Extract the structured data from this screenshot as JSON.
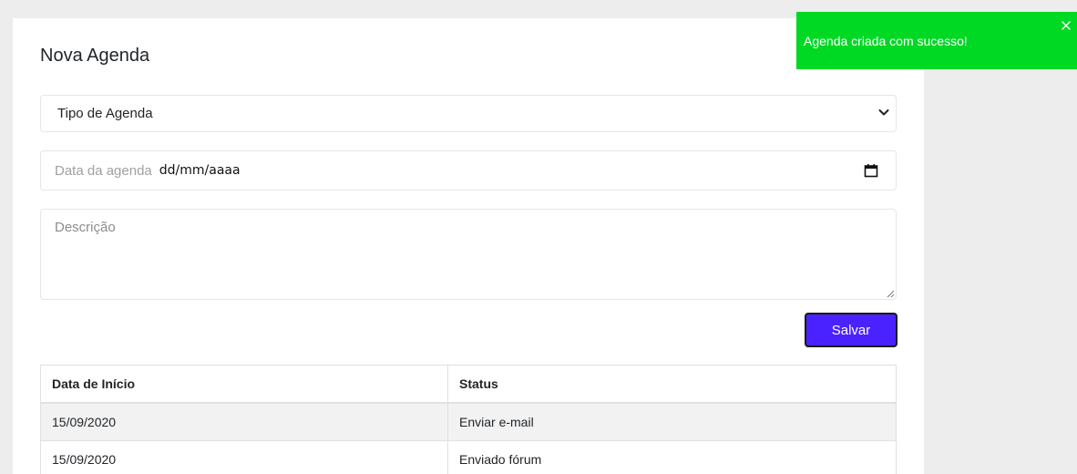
{
  "form": {
    "title": "Nova Agenda",
    "type_select": {
      "selected": "Tipo de Agenda"
    },
    "date_field": {
      "label": "Data da agenda",
      "value": "dd/mm/aaaa"
    },
    "description_field": {
      "placeholder": "Descrição"
    },
    "save_label": "Salvar"
  },
  "table": {
    "headers": [
      "Data de Início",
      "Status"
    ],
    "rows": [
      [
        "15/09/2020",
        "Enviar e-mail"
      ],
      [
        "15/09/2020",
        "Enviado fórum"
      ]
    ]
  },
  "toast": {
    "message": "Agenda criada com sucesso!",
    "color": "#00d924"
  },
  "colors": {
    "accent": "#4a22ff",
    "background": "#ededed"
  },
  "icons": {
    "select_arrow": "chevron-down-icon",
    "date_picker": "calendar-icon",
    "toast_close": "close-icon"
  }
}
